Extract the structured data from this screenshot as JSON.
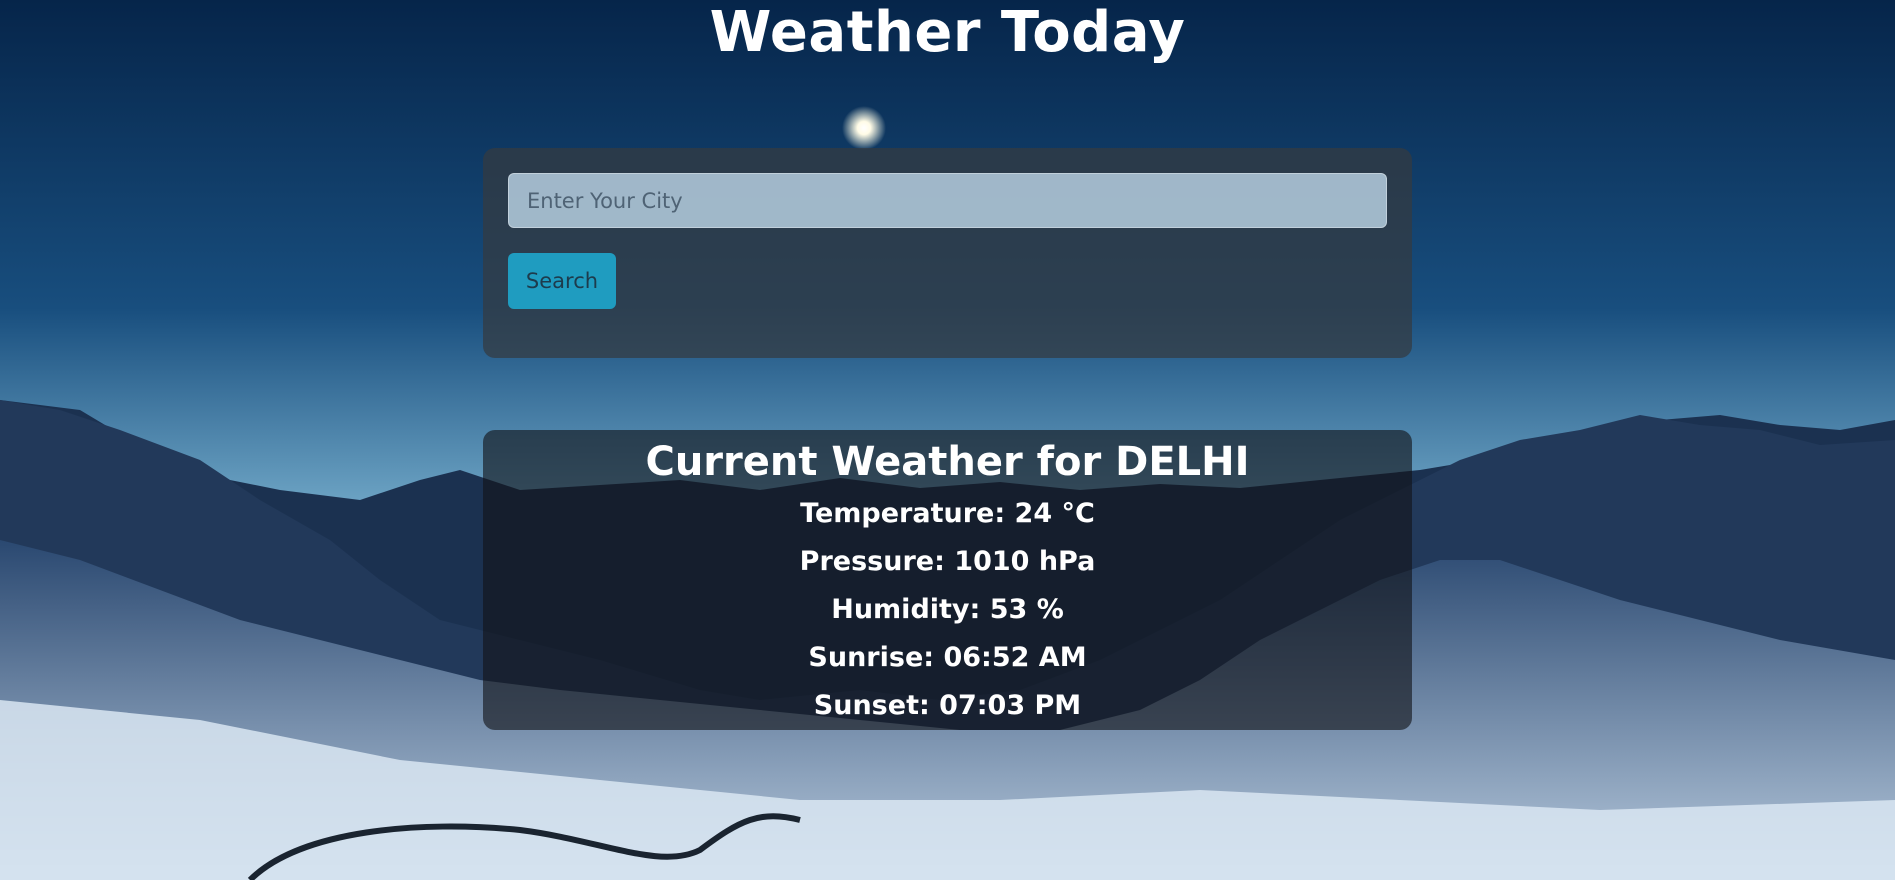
{
  "page": {
    "title": "Weather Today"
  },
  "search": {
    "placeholder": "Enter Your City",
    "value": "",
    "button_label": "Search"
  },
  "weather": {
    "heading": "Current Weather for DELHI",
    "temperature": "Temperature: 24 °C",
    "pressure": "Pressure: 1010 hPa",
    "humidity": "Humidity: 53 %",
    "sunrise": "Sunrise: 06:52 AM",
    "sunset": "Sunset: 07:03 PM"
  },
  "colors": {
    "sky_top": "#0a2a52",
    "sky_horizon": "#7fb2cf",
    "search_button": "#1f9cc0",
    "card_background": "#343a40"
  }
}
